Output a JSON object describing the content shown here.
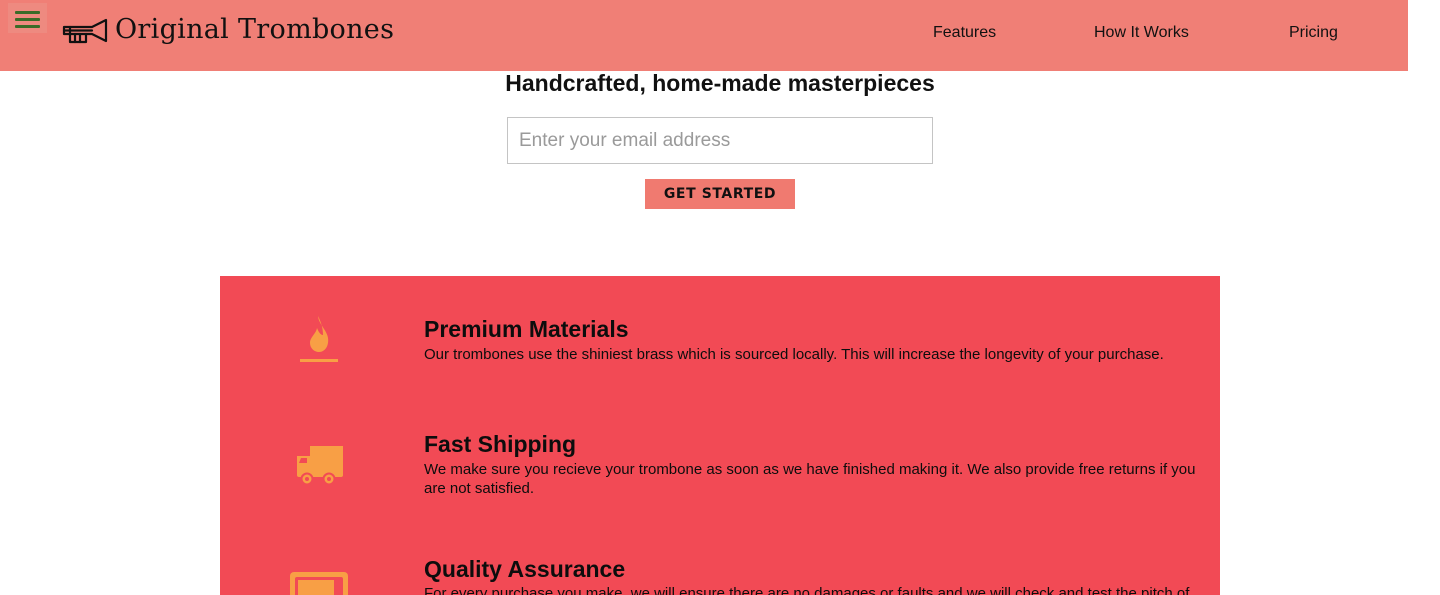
{
  "header": {
    "menu_icon": "hamburger-menu-icon",
    "logo_icon": "trombone-icon",
    "brand": "Original Trombones",
    "nav": [
      {
        "label": "Features"
      },
      {
        "label": "How It Works"
      },
      {
        "label": "Pricing"
      }
    ]
  },
  "hero": {
    "title": "Handcrafted, home-made masterpieces",
    "email_placeholder": "Enter your email address",
    "email_value": "",
    "cta_label": "GET STARTED"
  },
  "features": [
    {
      "icon": "fire-icon",
      "title": "Premium Materials",
      "desc": "Our trombones use the shiniest brass which is sourced locally. This will increase the longevity of your purchase."
    },
    {
      "icon": "truck-icon",
      "title": "Fast Shipping",
      "desc": "We make sure you recieve your trombone as soon as we have finished making it. We also provide free returns if you are not satisfied."
    },
    {
      "icon": "battery-icon",
      "title": "Quality Assurance",
      "desc": "For every purchase you make, we will ensure there are no damages or faults and we will check and test the pitch of"
    }
  ],
  "colors": {
    "header_bg": "#f07f76",
    "menu_bars": "#3a6b28",
    "cta_bg": "#f07a70",
    "features_bg": "#f24a55",
    "icon_color": "#f89f45"
  }
}
